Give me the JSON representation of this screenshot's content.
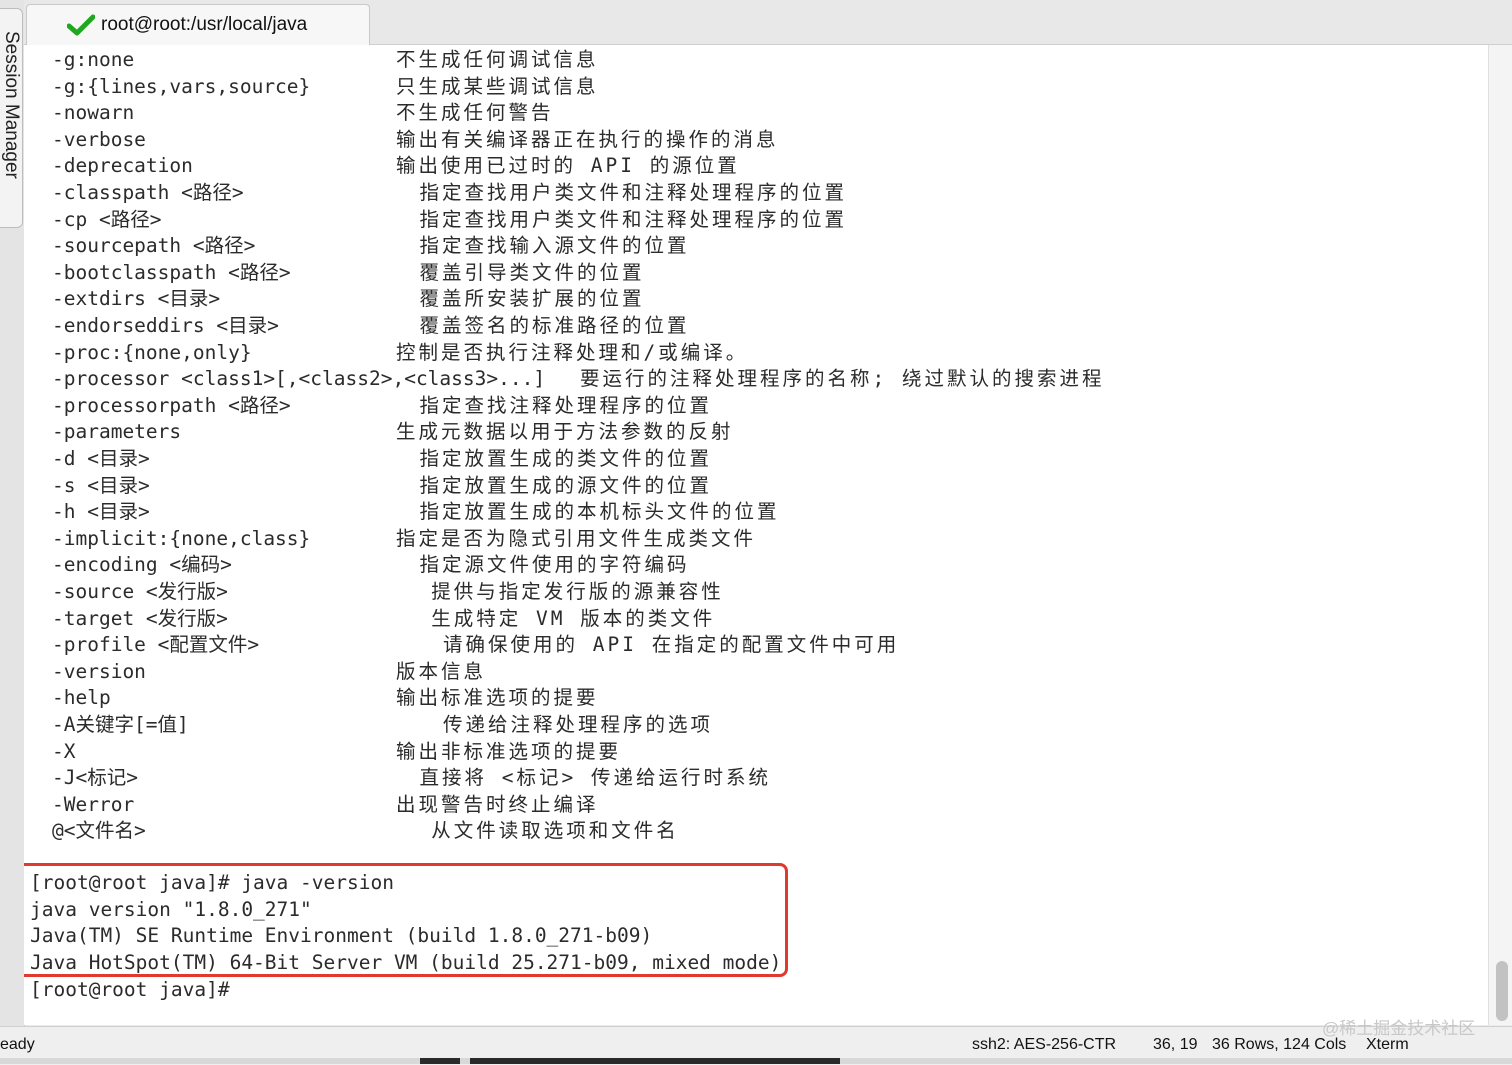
{
  "side_panel": {
    "label": "Session Manager"
  },
  "tab": {
    "title": "root@root:/usr/local/java",
    "status_icon": "check-icon",
    "status_color": "#1fa81f"
  },
  "help_lines": [
    {
      "option": "-g:none",
      "desc": "不生成任何调试信息",
      "indent": 0
    },
    {
      "option": "-g:{lines,vars,source}",
      "desc": "只生成某些调试信息",
      "indent": 0
    },
    {
      "option": "-nowarn",
      "desc": "不生成任何警告",
      "indent": 0
    },
    {
      "option": "-verbose",
      "desc": "输出有关编译器正在执行的操作的消息",
      "indent": 0
    },
    {
      "option": "-deprecation",
      "desc": "输出使用已过时的 API 的源位置",
      "indent": 0
    },
    {
      "option": "-classpath <路径>",
      "desc": "指定查找用户类文件和注释处理程序的位置",
      "indent": 2
    },
    {
      "option": "-cp <路径>",
      "desc": "指定查找用户类文件和注释处理程序的位置",
      "indent": 2
    },
    {
      "option": "-sourcepath <路径>",
      "desc": "指定查找输入源文件的位置",
      "indent": 2
    },
    {
      "option": "-bootclasspath <路径>",
      "desc": "覆盖引导类文件的位置",
      "indent": 2
    },
    {
      "option": "-extdirs <目录>",
      "desc": "覆盖所安装扩展的位置",
      "indent": 2
    },
    {
      "option": "-endorseddirs <目录>",
      "desc": "覆盖签名的标准路径的位置",
      "indent": 2
    },
    {
      "option": "-proc:{none,only}",
      "desc": "控制是否执行注释处理和/或编译。",
      "indent": 0
    },
    {
      "option": "-processor <class1>[,<class2>,<class3>...]",
      "desc": "要运行的注释处理程序的名称; 绕过默认的搜索进程",
      "indent": 16
    },
    {
      "option": "-processorpath <路径>",
      "desc": "指定查找注释处理程序的位置",
      "indent": 2
    },
    {
      "option": "-parameters",
      "desc": "生成元数据以用于方法参数的反射",
      "indent": 0
    },
    {
      "option": "-d <目录>",
      "desc": "指定放置生成的类文件的位置",
      "indent": 2
    },
    {
      "option": "-s <目录>",
      "desc": "指定放置生成的源文件的位置",
      "indent": 2
    },
    {
      "option": "-h <目录>",
      "desc": "指定放置生成的本机标头文件的位置",
      "indent": 2
    },
    {
      "option": "-implicit:{none,class}",
      "desc": "指定是否为隐式引用文件生成类文件",
      "indent": 0
    },
    {
      "option": "-encoding <编码>",
      "desc": "指定源文件使用的字符编码",
      "indent": 2
    },
    {
      "option": "-source <发行版>",
      "desc": "提供与指定发行版的源兼容性",
      "indent": 3
    },
    {
      "option": "-target <发行版>",
      "desc": "生成特定 VM 版本的类文件",
      "indent": 3
    },
    {
      "option": "-profile <配置文件>",
      "desc": "请确保使用的 API 在指定的配置文件中可用",
      "indent": 4
    },
    {
      "option": "-version",
      "desc": "版本信息",
      "indent": 0
    },
    {
      "option": "-help",
      "desc": "输出标准选项的提要",
      "indent": 0
    },
    {
      "option": "-A关键字[=值]",
      "desc": "传递给注释处理程序的选项",
      "indent": 4
    },
    {
      "option": "-X",
      "desc": "输出非标准选项的提要",
      "indent": 0
    },
    {
      "option": "-J<标记>",
      "desc": "直接将 <标记> 传递给运行时系统",
      "indent": 2
    },
    {
      "option": "-Werror",
      "desc": "出现警告时终止编译",
      "indent": 0
    },
    {
      "option": "@<文件名>",
      "desc": "从文件读取选项和文件名",
      "indent": 3
    }
  ],
  "command_output": [
    "[root@root java]# java -version",
    "java version \"1.8.0_271\"",
    "Java(TM) SE Runtime Environment (build 1.8.0_271-b09)",
    "Java HotSpot(TM) 64-Bit Server VM (build 25.271-b09, mixed mode)"
  ],
  "prompt": "[root@root java]#",
  "highlight_color": "#e0392f",
  "status_bar": {
    "ready": "eady",
    "cipher": "ssh2: AES-256-CTR",
    "cursor": "36, 19",
    "size": "36 Rows, 124 Cols",
    "terminal_type": "Xterm"
  },
  "watermark": "@稀土掘金技术社区"
}
